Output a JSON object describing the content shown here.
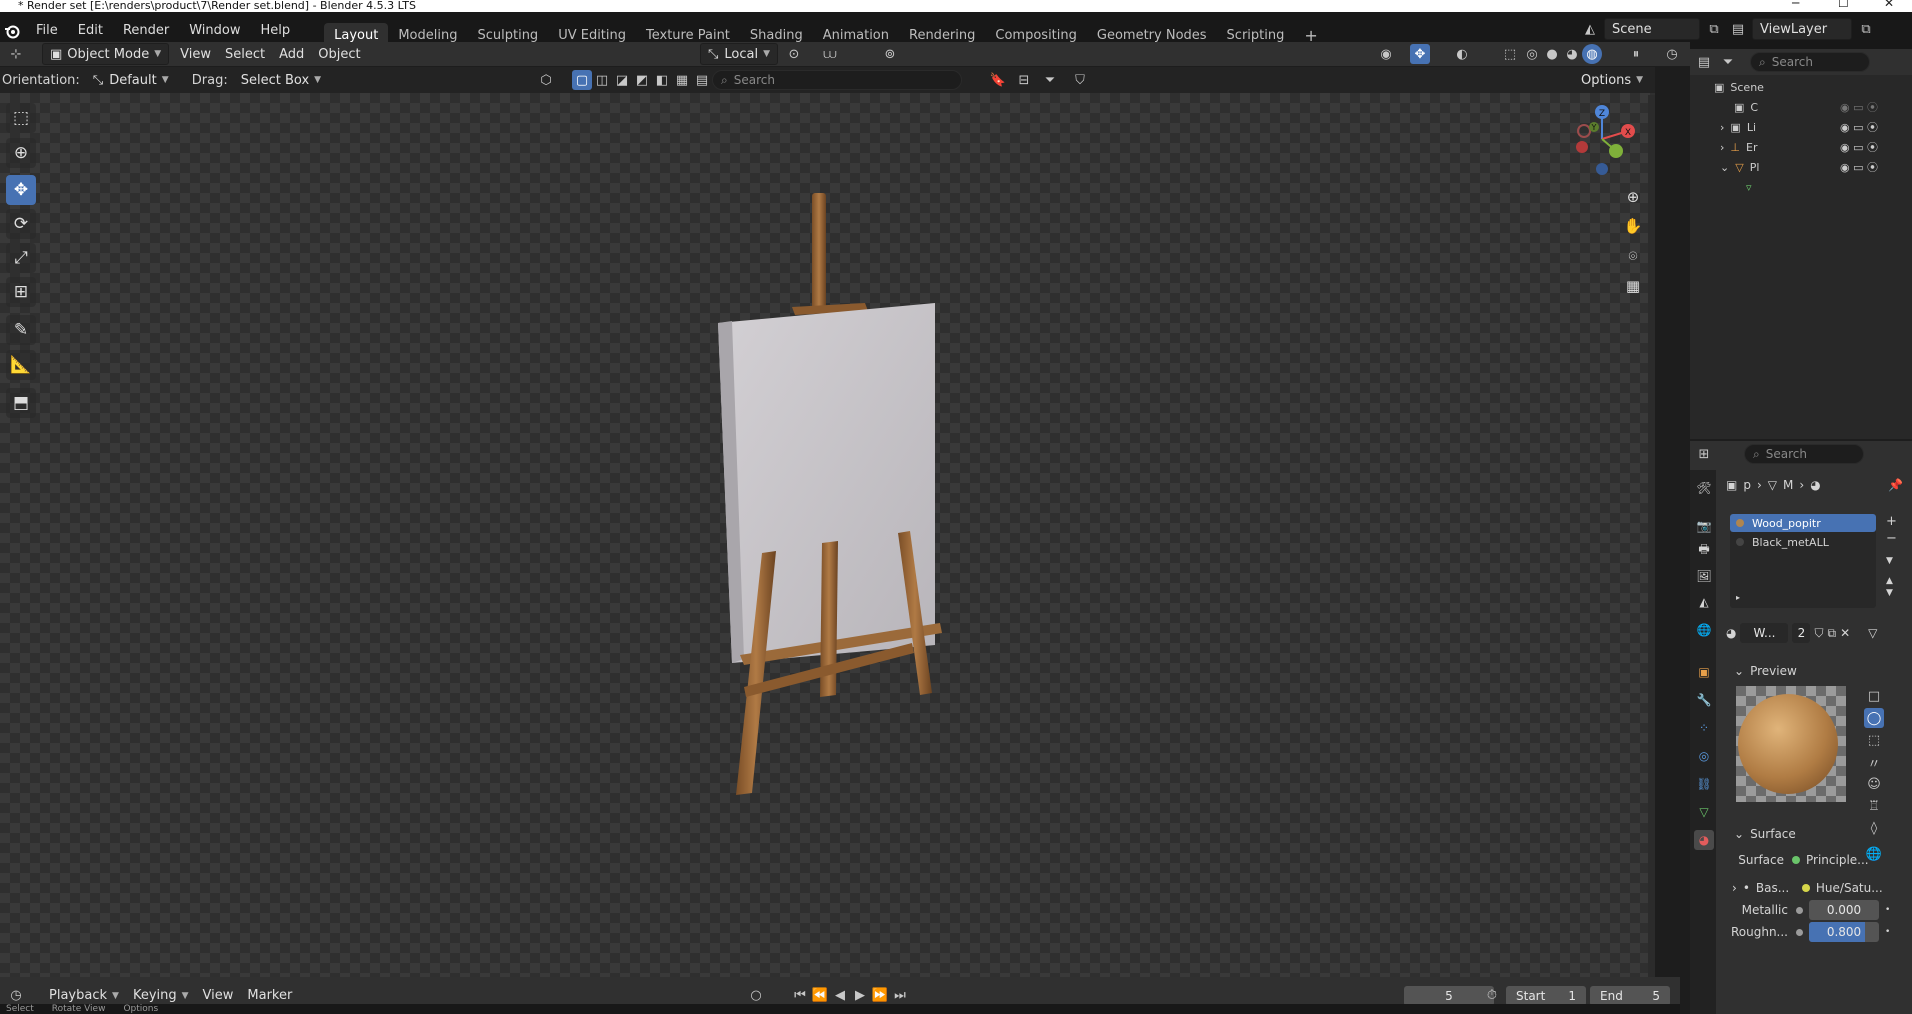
{
  "window": {
    "title": "* Render set [E:\\renders\\product\\7\\Render set.blend] - Blender 4.5.3 LTS",
    "minimize": "─",
    "maximize": "☐",
    "close": "✕"
  },
  "menu": [
    "File",
    "Edit",
    "Render",
    "Window",
    "Help"
  ],
  "workspaces": {
    "active": "Layout",
    "tabs": [
      "Layout",
      "Modeling",
      "Sculpting",
      "UV Editing",
      "Texture Paint",
      "Shading",
      "Animation",
      "Rendering",
      "Compositing",
      "Geometry Nodes",
      "Scripting"
    ],
    "add": "+"
  },
  "scene": {
    "name": "Scene",
    "view_layer": "ViewLayer"
  },
  "viewport_header": {
    "mode": "Object Mode",
    "menus": [
      "View",
      "Select",
      "Add",
      "Object"
    ],
    "transform_space": "Local"
  },
  "tool_header": {
    "orientation_label": "Orientation:",
    "orientation_value": "Default",
    "drag_label": "Drag:",
    "drag_value": "Select Box",
    "search_placeholder": "Search",
    "options": "Options"
  },
  "gizmo": {
    "x": "X",
    "y": "Y",
    "z": "Z"
  },
  "outliner": {
    "search_placeholder": "Search",
    "root": "Scene",
    "rows": [
      "C",
      "Li",
      "Er",
      "Pl"
    ]
  },
  "properties": {
    "search_placeholder": "Search",
    "breadcrumb": [
      "p",
      "M"
    ],
    "material_slots": [
      "Wood_popitr",
      "Black_metALL"
    ],
    "material_name": "W...",
    "users": "2",
    "preview_label": "Preview",
    "surface_panel": "Surface",
    "surface_label": "Surface",
    "surface_value": "Principle...",
    "base_label": "Bas...",
    "base_value": "Hue/Satu...",
    "metallic_label": "Metallic",
    "metallic_value": "0.000",
    "metallic_fraction": 0.0,
    "roughness_label": "Roughn...",
    "roughness_value": "0.800",
    "roughness_fraction": 0.8
  },
  "timeline": {
    "menus": [
      "Playback",
      "Keying",
      "View",
      "Marker"
    ],
    "current_frame": "5",
    "start_label": "Start",
    "start_value": "1",
    "end_label": "End",
    "end_value": "5"
  },
  "statusbar": {
    "items": [
      "Select",
      "Rotate View",
      "Options"
    ]
  },
  "colors": {
    "accent": "#4772b3",
    "canvas": "#c2bfc3",
    "wood": "#9b6a3a",
    "wood_dark": "#6d4622"
  }
}
